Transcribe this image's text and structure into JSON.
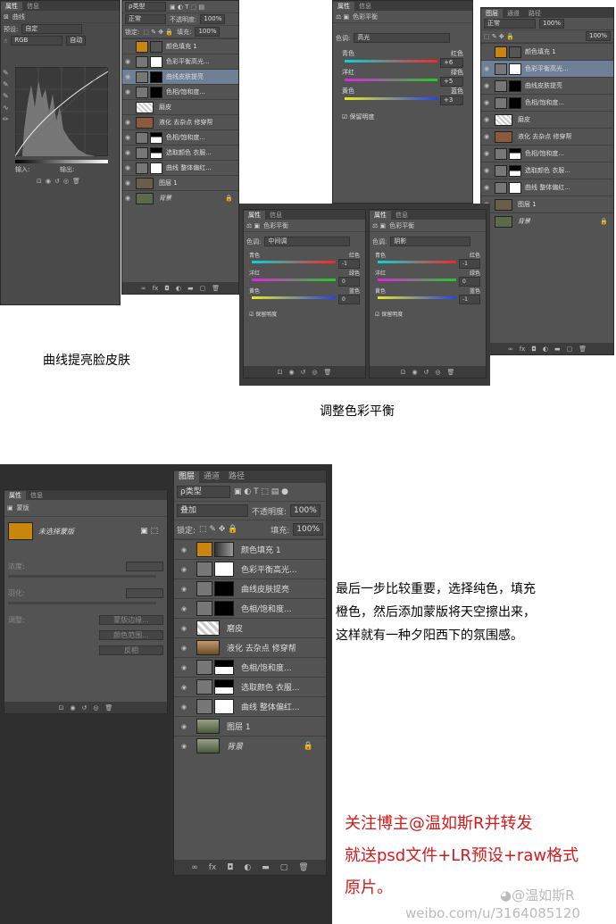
{
  "colors": {
    "orange_fill": "#c8860c",
    "red_text": "#d31a1a",
    "selected_row": "#6f7f95",
    "panel_bg": "#535353"
  },
  "panel_tabs": {
    "properties": "属性",
    "info": "信息",
    "layers": "图层",
    "channels": "通道",
    "paths": "路径"
  },
  "curves": {
    "title": "曲线",
    "preset": "自定",
    "channel": "RGB",
    "auto": "自动",
    "input": "输入:",
    "output": "输出:"
  },
  "layers_top": {
    "filter": "ρ类型",
    "blend": "正常",
    "opacity_label": "不透明度:",
    "opacity": "100%",
    "lock_label": "锁定:",
    "fill_label": "填充:",
    "fill": "100%",
    "rows": [
      "颜色填充 1",
      "色彩平衡高光...",
      "曲线皮肤提亮",
      "色相/饱和度...",
      "磨皮",
      "液化 去杂点 修穿帮",
      "色相/饱和度...",
      "选取颜色 衣服...",
      "曲线 整体偏红...",
      "图层 1",
      "背景"
    ]
  },
  "color_balance_1": {
    "title": "色彩平衡",
    "tone_label": "色调:",
    "tone": "高光",
    "cyan": "青色",
    "red": "红色",
    "magenta": "洋红",
    "green": "绿色",
    "yellow": "黄色",
    "blue": "蓝色",
    "v1": "+6",
    "v2": "+5",
    "v3": "+3",
    "preserve": "保留明度"
  },
  "color_balance_2": {
    "tone": "中间调",
    "v1": "-1",
    "v2": "0",
    "v3": "0"
  },
  "color_balance_3": {
    "tone": "阴影",
    "v1": "-1",
    "v2": "0",
    "v3": "-1"
  },
  "layers_right": {
    "blend": "正常",
    "opacity": "100%",
    "fill": "100%",
    "rows": [
      "颜色填充 1",
      "色彩平衡高光...",
      "曲线皮肤提亮",
      "色相/饱和度...",
      "磨皮",
      "液化 去杂点 修穿帮",
      "色相/饱和度...",
      "选取颜色 衣服...",
      "曲线 整体偏红...",
      "图层 1",
      "背景"
    ]
  },
  "mask_panel": {
    "title": "蒙版",
    "no_mask": "未选择蒙版",
    "density": "浓度:",
    "feather": "羽化:",
    "refine": "调整:",
    "edge_btn": "蒙版边缘...",
    "range_btn": "颜色范围...",
    "invert_btn": "反相"
  },
  "layers_big": {
    "filter": "ρ类型",
    "blend": "叠加",
    "opacity_label": "不透明度:",
    "opacity": "100%",
    "lock_label": "锁定:",
    "fill_label": "填充:",
    "fill": "100%",
    "rows": [
      "颜色填充 1",
      "色彩平衡高光...",
      "曲线皮肤提亮",
      "色相/饱和度...",
      "磨皮",
      "液化 去杂点 修穿帮",
      "色相/饱和度...",
      "选取颜色 衣服...",
      "曲线 整体偏红...",
      "图层 1",
      "背景"
    ]
  },
  "captions": {
    "curves": "曲线提亮脸皮肤",
    "balance": "调整色彩平衡",
    "last_step_1": "最后一步比较重要，选择纯色，填充",
    "last_step_2": "橙色，然后添加蒙版将天空擦出来，",
    "last_step_3": "这样就有一种夕阳西下的氛围感。",
    "promo_1": "关注博主@温如斯R并转发",
    "promo_2": "就送psd文件+LR预设+raw格式",
    "promo_3": "原片。",
    "watermark_name": "@温如斯R",
    "watermark_url": "weibo.com/u/3164085120"
  }
}
